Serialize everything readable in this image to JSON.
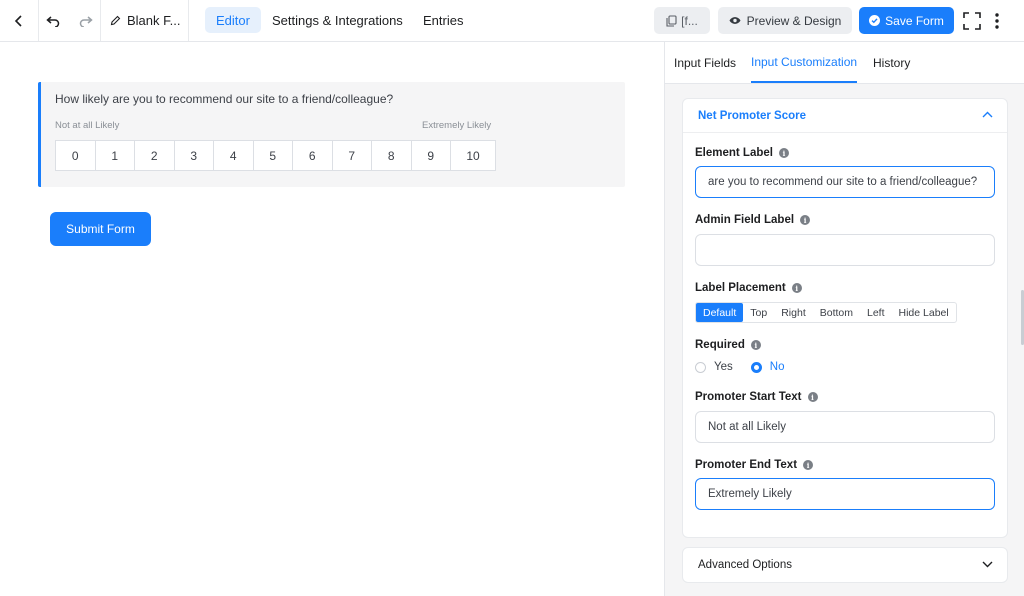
{
  "topbar": {
    "form_name": "Blank F...",
    "tabs": [
      {
        "label": "Editor",
        "active": true
      },
      {
        "label": "Settings & Integrations",
        "active": false
      },
      {
        "label": "Entries",
        "active": false
      }
    ],
    "shortcode_label": "[f...",
    "preview_label": "Preview & Design",
    "save_label": "Save Form",
    "icons": {
      "back": "chevron-left-icon",
      "undo": "undo-icon",
      "redo": "redo-icon",
      "rename": "pencil-icon",
      "shortcode": "copy-icon",
      "preview": "eye-icon",
      "save": "check-circle-icon",
      "fullscreen": "fullscreen-icon",
      "more": "vertical-dots-icon"
    }
  },
  "canvas": {
    "question": "How likely are you to recommend our site to a friend/colleague?",
    "start_text": "Not at all Likely",
    "end_text": "Extremely Likely",
    "scale": [
      "0",
      "1",
      "2",
      "3",
      "4",
      "5",
      "6",
      "7",
      "8",
      "9",
      "10"
    ],
    "submit_label": "Submit Form"
  },
  "panel": {
    "tabs": [
      {
        "label": "Input Fields",
        "active": false
      },
      {
        "label": "Input Customization",
        "active": true
      },
      {
        "label": "History",
        "active": false
      }
    ],
    "section_title": "Net Promoter Score",
    "element_label": {
      "label": "Element Label",
      "value": "are you to recommend our site to a friend/colleague?"
    },
    "admin_label": {
      "label": "Admin Field Label",
      "value": ""
    },
    "label_placement": {
      "label": "Label Placement",
      "options": [
        "Default",
        "Top",
        "Right",
        "Bottom",
        "Left",
        "Hide Label"
      ],
      "selected": "Default"
    },
    "required": {
      "label": "Required",
      "options": [
        "Yes",
        "No"
      ],
      "selected": "No"
    },
    "promoter_start": {
      "label": "Promoter Start Text",
      "value": "Not at all Likely"
    },
    "promoter_end": {
      "label": "Promoter End Text",
      "value": "Extremely Likely"
    },
    "advanced_label": "Advanced Options"
  },
  "colors": {
    "accent": "#1a7efb",
    "panel_bg": "#f5f5f6"
  }
}
